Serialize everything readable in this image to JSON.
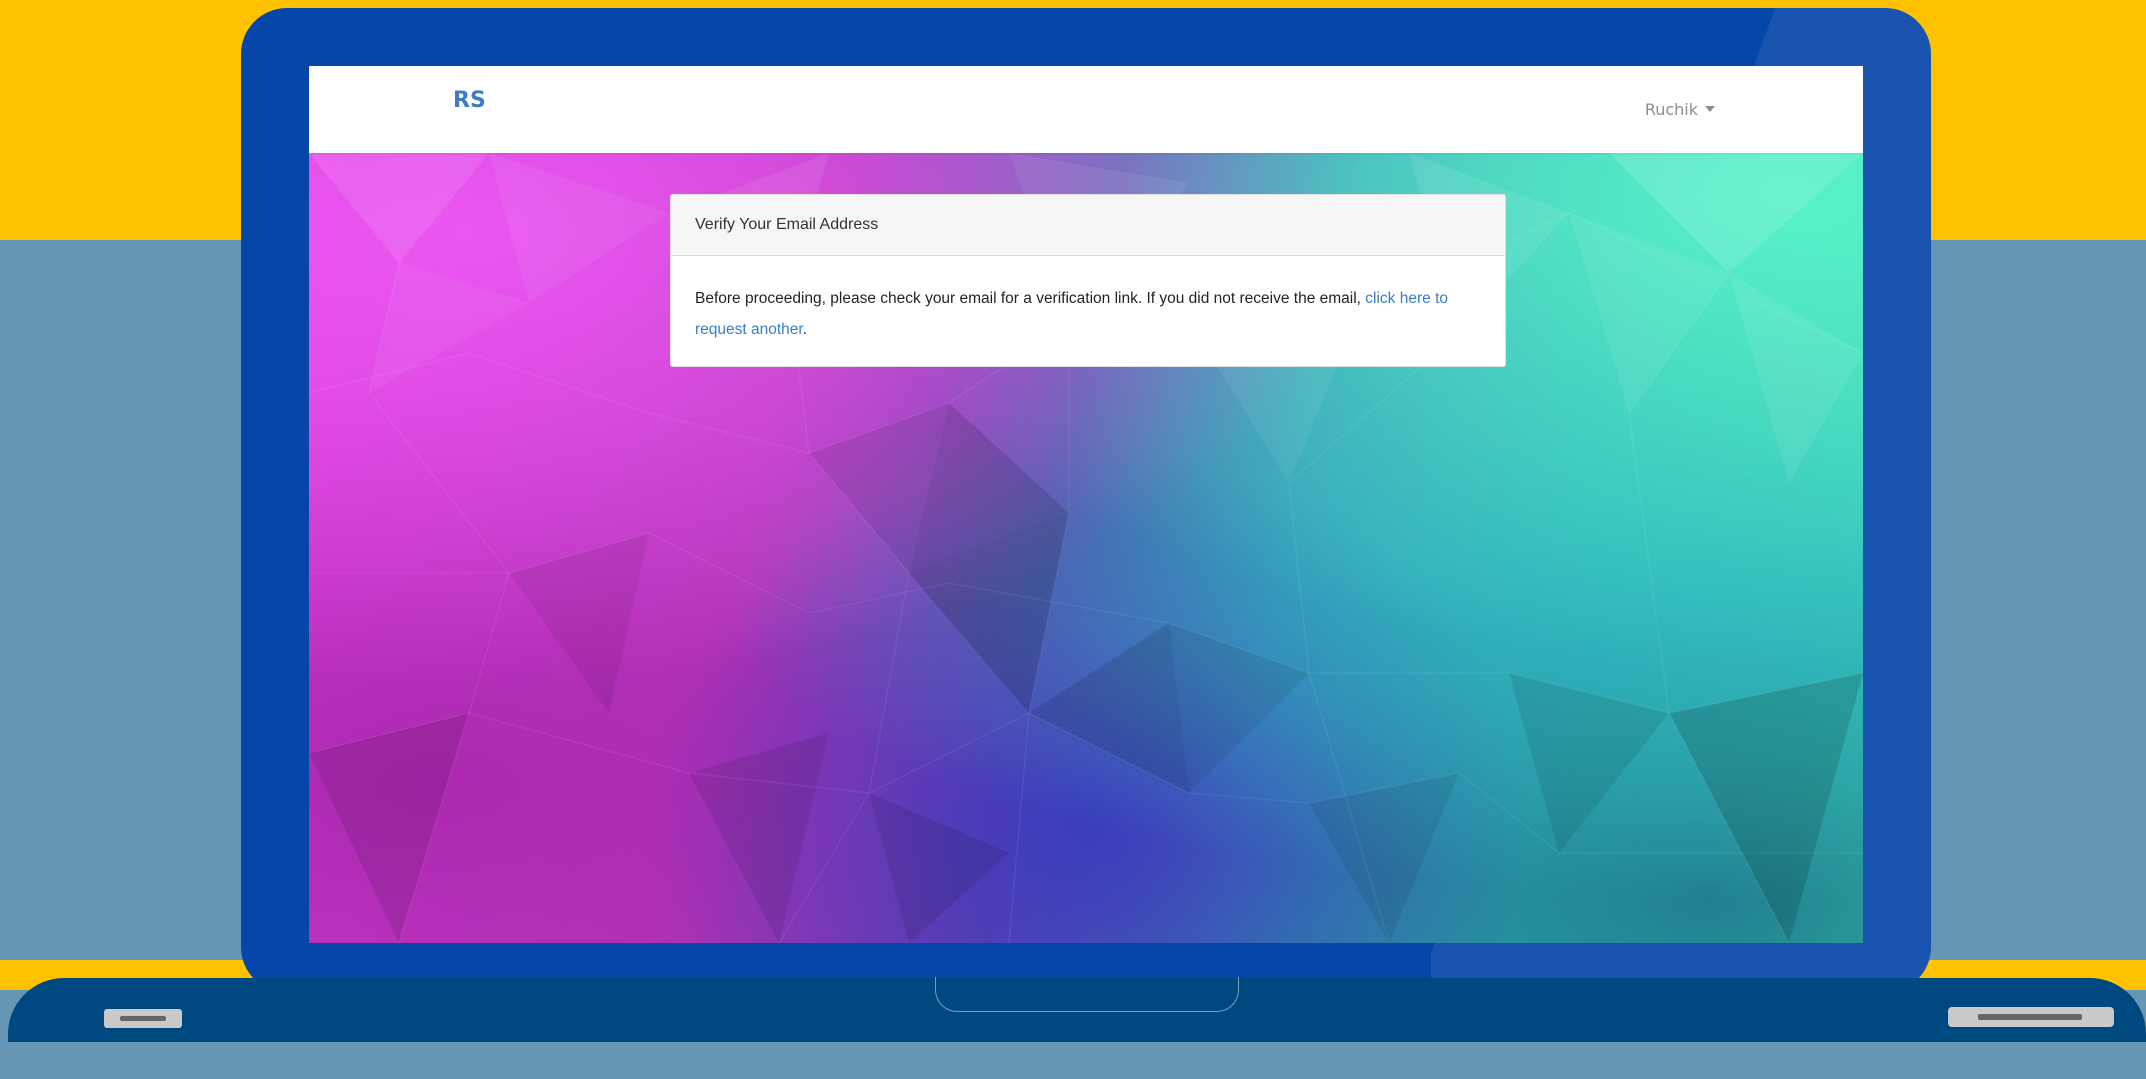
{
  "navbar": {
    "brand": "RS",
    "user_name": "Ruchik"
  },
  "card": {
    "header": "Verify Your Email Address",
    "body_text": "Before proceeding, please check your email for a verification link. If you did not receive the email,",
    "link_text": "click here to request another",
    "trailing": "."
  },
  "colors": {
    "brand": "#3a7fc4",
    "link": "#3a7fc4",
    "laptop_frame": "#0447a8",
    "laptop_base": "#004880",
    "background_top": "#ffc200",
    "background_bottom": "#6597b5"
  }
}
